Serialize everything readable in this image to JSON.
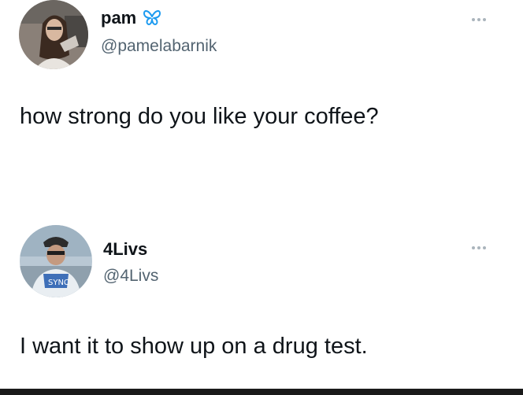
{
  "tweets": [
    {
      "display_name": "pam",
      "handle": "@pamelabarnik",
      "text": "how strong do you like your coffee?",
      "badge_icon": "butterfly-icon",
      "badge_color": "#1d9bf0"
    },
    {
      "display_name": "4Livs",
      "handle": "@4Livs",
      "text": "I want it to show up on a drug test."
    }
  ],
  "colors": {
    "text_primary": "#0f1419",
    "text_secondary": "#536471",
    "more_icon": "#aab4bc"
  }
}
